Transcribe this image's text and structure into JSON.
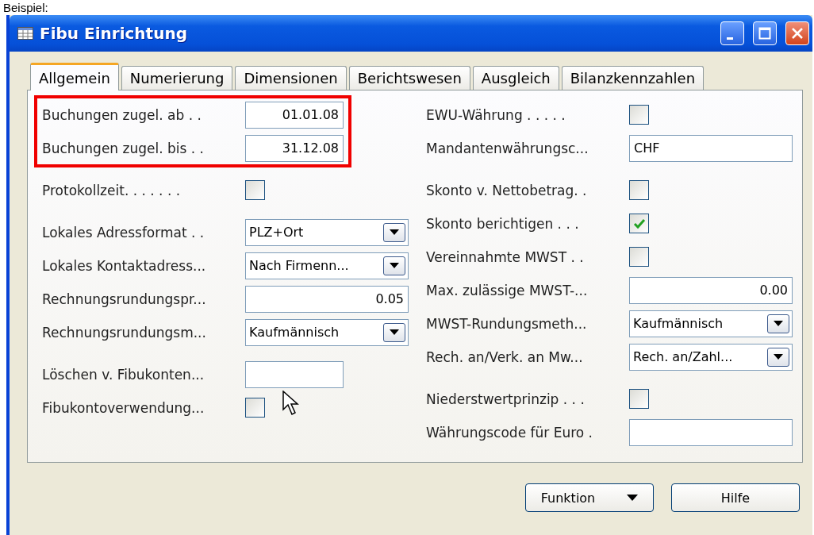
{
  "caption": "Beispiel:",
  "window": {
    "title": "Fibu Einrichtung"
  },
  "tabs": [
    {
      "label": "Allgemein",
      "selected": true
    },
    {
      "label": "Numerierung",
      "selected": false
    },
    {
      "label": "Dimensionen",
      "selected": false
    },
    {
      "label": "Berichtswesen",
      "selected": false
    },
    {
      "label": "Ausgleich",
      "selected": false
    },
    {
      "label": "Bilanzkennzahlen",
      "selected": false
    }
  ],
  "left_column": [
    [
      {
        "kind": "short_text",
        "label": "Buchungen zugel. ab . .",
        "value": "01.01.08",
        "highlighted": true
      },
      {
        "kind": "short_text",
        "label": "Buchungen zugel. bis . .",
        "value": "31.12.08",
        "highlighted": true
      }
    ],
    [
      {
        "kind": "checkbox",
        "label": "Protokollzeit. . . . . . .",
        "checked": false
      }
    ],
    [
      {
        "kind": "dropdown",
        "label": "Lokales Adressformat . .",
        "value": "PLZ+Ort"
      },
      {
        "kind": "dropdown",
        "label": "Lokales Kontaktadress...",
        "value": "Nach Firmenn..."
      },
      {
        "kind": "number",
        "label": "Rechnungsrundungspr...",
        "value": "0.05"
      },
      {
        "kind": "dropdown",
        "label": "Rechnungsrundungsm...",
        "value": "Kaufmännisch"
      }
    ],
    [
      {
        "kind": "short_text",
        "label": "Löschen v. Fibukonten..."
      },
      {
        "kind": "checkbox",
        "label": "Fibukontoverwendung...",
        "checked": false
      }
    ]
  ],
  "right_column": [
    [
      {
        "kind": "checkbox",
        "label": "EWU-Währung . . . . .",
        "checked": false
      },
      {
        "kind": "text",
        "label": "Mandantenwährungsc...",
        "value": "CHF"
      }
    ],
    [
      {
        "kind": "checkbox",
        "label": "Skonto v. Nettobetrag. .",
        "checked": false
      },
      {
        "kind": "checkbox",
        "label": "Skonto berichtigen . . .",
        "checked": true
      },
      {
        "kind": "checkbox",
        "label": "Vereinnahmte MWST . .",
        "checked": false
      },
      {
        "kind": "number",
        "label": "Max. zulässige MWST-...",
        "value": "0.00"
      },
      {
        "kind": "dropdown",
        "label": "MWST-Rundungsmeth...",
        "value": "Kaufmännisch"
      },
      {
        "kind": "dropdown",
        "label": "Rech. an/Verk. an Mw...",
        "value": "Rech. an/Zahl..."
      }
    ],
    [
      {
        "kind": "checkbox",
        "label": "Niederstwertprinzip . . .",
        "checked": false
      },
      {
        "kind": "text",
        "label": "Währungscode für Euro ."
      }
    ]
  ],
  "buttons": [
    {
      "label": "Funktion",
      "kind": "menu"
    },
    {
      "label": "Hilfe",
      "kind": "plain"
    }
  ]
}
